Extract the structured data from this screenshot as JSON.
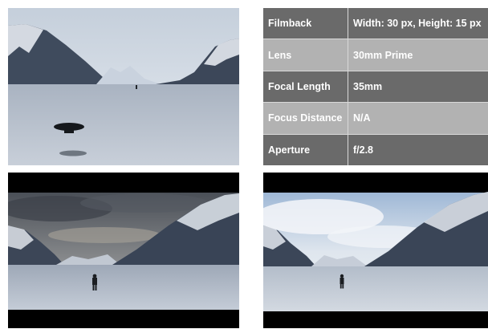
{
  "colors": {
    "row_dark": "#6a6a6a",
    "row_light": "#b2b2b2",
    "letterbox": "#000000",
    "ice": "#cfd5de",
    "mountain": "#3e4a5c",
    "snow": "#e9edf2"
  },
  "frames": {
    "top_left": {
      "content": "drone-over-frozen-lake"
    },
    "bottom_left": {
      "content": "figure-on-frozen-lake-cloudy"
    },
    "bottom_right": {
      "content": "figure-on-frozen-lake-bright"
    }
  },
  "camera_settings": {
    "rows": [
      {
        "label": "Filmback",
        "value": "Width: 30 px, Height: 15 px"
      },
      {
        "label": "Lens",
        "value": "30mm Prime"
      },
      {
        "label": "Focal Length",
        "value": "35mm"
      },
      {
        "label": "Focus Distance",
        "value": "N/A"
      },
      {
        "label": "Aperture",
        "value": "f/2.8"
      }
    ]
  }
}
